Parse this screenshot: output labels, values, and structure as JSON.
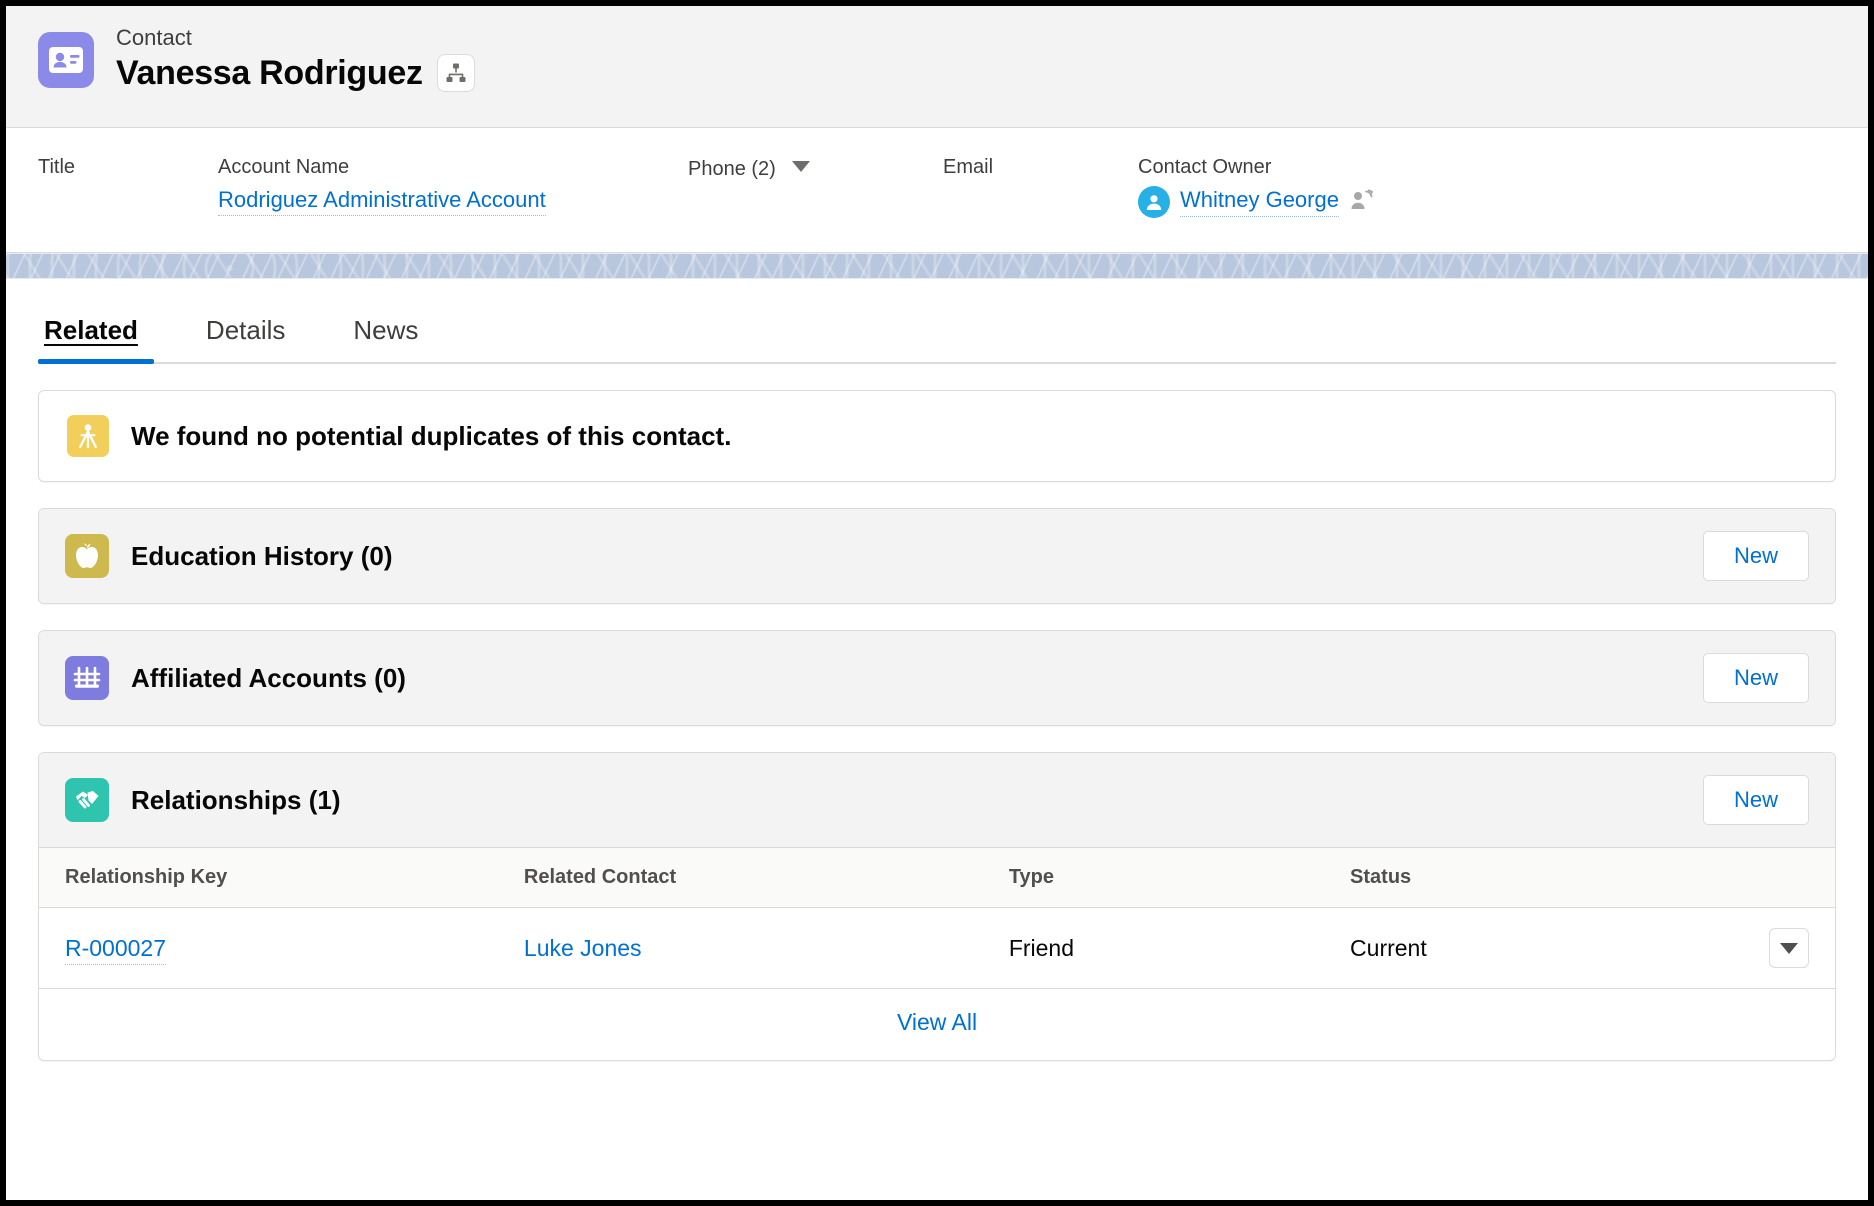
{
  "record_header": {
    "object_type": "Contact",
    "record_name": "Vanessa Rodriguez",
    "record_icon": "contact-card-icon",
    "record_icon_color": "#8c8ae8",
    "hierarchy_icon": "hierarchy-icon"
  },
  "highlights": {
    "fields": [
      {
        "label": "Title",
        "value": ""
      },
      {
        "label": "Account Name",
        "value": "Rodriguez Administrative Account",
        "is_link": true
      },
      {
        "label": "Phone (2)",
        "value": "",
        "has_caret": true
      },
      {
        "label": "Email",
        "value": ""
      },
      {
        "label": "Contact Owner",
        "value": "Whitney George",
        "is_link": true,
        "avatar": "user-avatar-icon",
        "trailing_icon": "change-owner-icon"
      }
    ]
  },
  "tabs": [
    {
      "label": "Related",
      "active": true
    },
    {
      "label": "Details",
      "active": false
    },
    {
      "label": "News",
      "active": false
    }
  ],
  "duplicates_alert": {
    "icon": "duplicate-merge-icon",
    "icon_color": "#f2cf5b",
    "message": "We found no potential duplicates of this contact."
  },
  "sections": [
    {
      "title": "Education History (0)",
      "icon": "apple-icon",
      "icon_color": "#cdb94e",
      "action_label": "New",
      "has_table": false
    },
    {
      "title": "Affiliated Accounts (0)",
      "icon": "bridge-icon",
      "icon_color": "#7f7ce0",
      "action_label": "New",
      "has_table": false
    },
    {
      "title": "Relationships (1)",
      "icon": "handshake-icon",
      "icon_color": "#2fc4ad",
      "action_label": "New",
      "has_table": true
    }
  ],
  "relationships_table": {
    "columns": [
      "Relationship Key",
      "Related Contact",
      "Type",
      "Status"
    ],
    "rows": [
      {
        "relationship_key": "R-000027",
        "related_contact": "Luke Jones",
        "type": "Friend",
        "status": "Current",
        "row_menu_icon": "chevron-down-icon"
      }
    ],
    "footer_link": "View All"
  },
  "colors": {
    "link": "#0070d2",
    "tab_active_underline": "#0070d2",
    "section_header_bg": "#f3f3f3",
    "theme_band": "#b9c7de"
  }
}
